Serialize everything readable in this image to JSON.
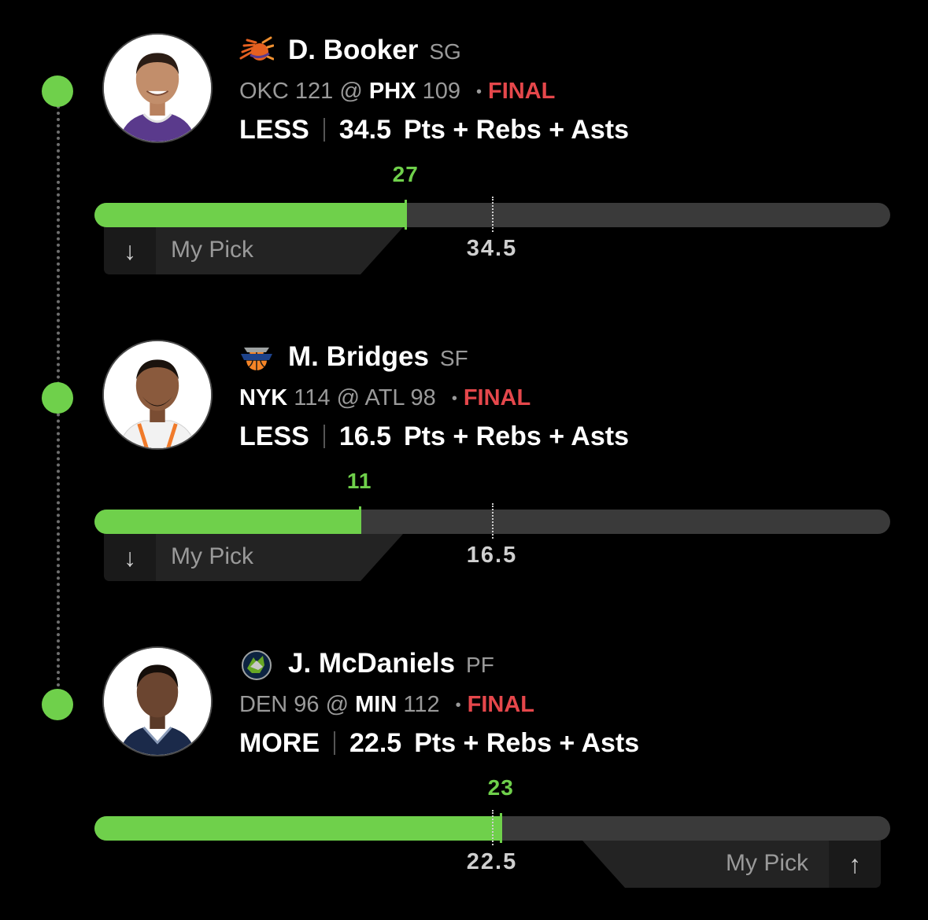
{
  "colors": {
    "accent": "#6fd04b",
    "final": "#e5474b",
    "muted": "#9a9a9a"
  },
  "picks": [
    {
      "player": {
        "name": "D. Booker",
        "position": "SG",
        "team_logo": "suns-logo"
      },
      "game": {
        "away_team": "OKC",
        "away_score": "121",
        "at": "@",
        "home_team": "PHX",
        "home_score": "109",
        "bold_team": "home",
        "sep": "•",
        "status": "FINAL"
      },
      "prop": {
        "direction": "LESS",
        "line": "34.5",
        "stat": "Pts + Rebs + Asts"
      },
      "result": {
        "actual": "27",
        "actual_value": 27,
        "line_value": 34.5,
        "line_label": "34.5",
        "scale_max": 64
      },
      "pick": {
        "label": "My Pick",
        "arrow": "↓",
        "side": "left"
      }
    },
    {
      "player": {
        "name": "M. Bridges",
        "position": "SF",
        "team_logo": "knicks-logo"
      },
      "game": {
        "away_team": "NYK",
        "away_score": "114",
        "at": "@",
        "home_team": "ATL",
        "home_score": "98",
        "bold_team": "away",
        "sep": "•",
        "status": "FINAL"
      },
      "prop": {
        "direction": "LESS",
        "line": "16.5",
        "stat": "Pts + Rebs + Asts"
      },
      "result": {
        "actual": "11",
        "actual_value": 11,
        "line_value": 16.5,
        "line_label": "16.5",
        "scale_max": 33
      },
      "pick": {
        "label": "My Pick",
        "arrow": "↓",
        "side": "left"
      }
    },
    {
      "player": {
        "name": "J. McDaniels",
        "position": "PF",
        "team_logo": "timberwolves-logo"
      },
      "game": {
        "away_team": "DEN",
        "away_score": "96",
        "at": "@",
        "home_team": "MIN",
        "home_score": "112",
        "bold_team": "home",
        "sep": "•",
        "status": "FINAL"
      },
      "prop": {
        "direction": "MORE",
        "line": "22.5",
        "stat": "Pts + Rebs + Asts"
      },
      "result": {
        "actual": "23",
        "actual_value": 23,
        "line_value": 22.5,
        "line_label": "22.5",
        "scale_max": 45
      },
      "pick": {
        "label": "My Pick",
        "arrow": "↑",
        "side": "right"
      }
    }
  ]
}
